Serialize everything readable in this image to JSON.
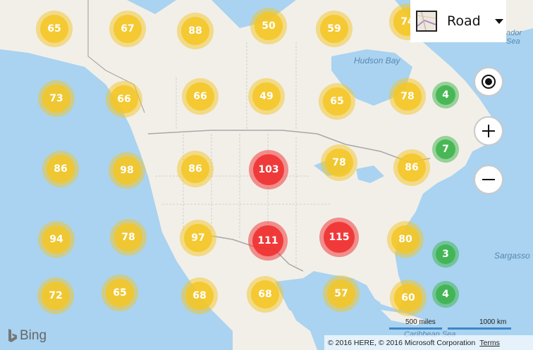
{
  "map": {
    "clusters": [
      {
        "count": "65",
        "level": "medium"
      },
      {
        "count": "67",
        "level": "medium"
      },
      {
        "count": "88",
        "level": "medium"
      },
      {
        "count": "50",
        "level": "medium"
      },
      {
        "count": "59",
        "level": "medium"
      },
      {
        "count": "74",
        "level": "medium"
      },
      {
        "count": "73",
        "level": "medium"
      },
      {
        "count": "66",
        "level": "medium"
      },
      {
        "count": "66",
        "level": "medium"
      },
      {
        "count": "49",
        "level": "medium"
      },
      {
        "count": "65",
        "level": "medium"
      },
      {
        "count": "78",
        "level": "medium"
      },
      {
        "count": "4",
        "level": "small"
      },
      {
        "count": "86",
        "level": "medium"
      },
      {
        "count": "98",
        "level": "medium"
      },
      {
        "count": "86",
        "level": "medium"
      },
      {
        "count": "103",
        "level": "large"
      },
      {
        "count": "78",
        "level": "medium"
      },
      {
        "count": "86",
        "level": "medium"
      },
      {
        "count": "7",
        "level": "small"
      },
      {
        "count": "94",
        "level": "medium"
      },
      {
        "count": "78",
        "level": "medium"
      },
      {
        "count": "97",
        "level": "medium"
      },
      {
        "count": "111",
        "level": "large"
      },
      {
        "count": "115",
        "level": "large"
      },
      {
        "count": "80",
        "level": "medium"
      },
      {
        "count": "3",
        "level": "small"
      },
      {
        "count": "72",
        "level": "medium"
      },
      {
        "count": "65",
        "level": "medium"
      },
      {
        "count": "68",
        "level": "medium"
      },
      {
        "count": "68",
        "level": "medium"
      },
      {
        "count": "57",
        "level": "medium"
      },
      {
        "count": "60",
        "level": "medium"
      },
      {
        "count": "4",
        "level": "small"
      }
    ],
    "labels": {
      "hudson_bay": "Hudson Bay",
      "labrador": "ador Sea",
      "sargasso": "Sargasso",
      "caribbean": "Caribbean Sea"
    }
  },
  "colors": {
    "water": "#a9d3f0",
    "land": "#f2efe9",
    "cluster_small": "#3cb34a",
    "cluster_medium": "#f3c623",
    "cluster_large": "#f02c2c"
  },
  "controls": {
    "map_style_label": "Road",
    "locate_icon": "target-icon",
    "zoom_in_icon": "plus-icon",
    "zoom_out_icon": "minus-icon"
  },
  "footer": {
    "brand": "Bing",
    "scale_miles": "500 miles",
    "scale_km": "1000 km",
    "copyright": "© 2016 HERE, © 2016 Microsoft Corporation",
    "terms": "Terms"
  }
}
